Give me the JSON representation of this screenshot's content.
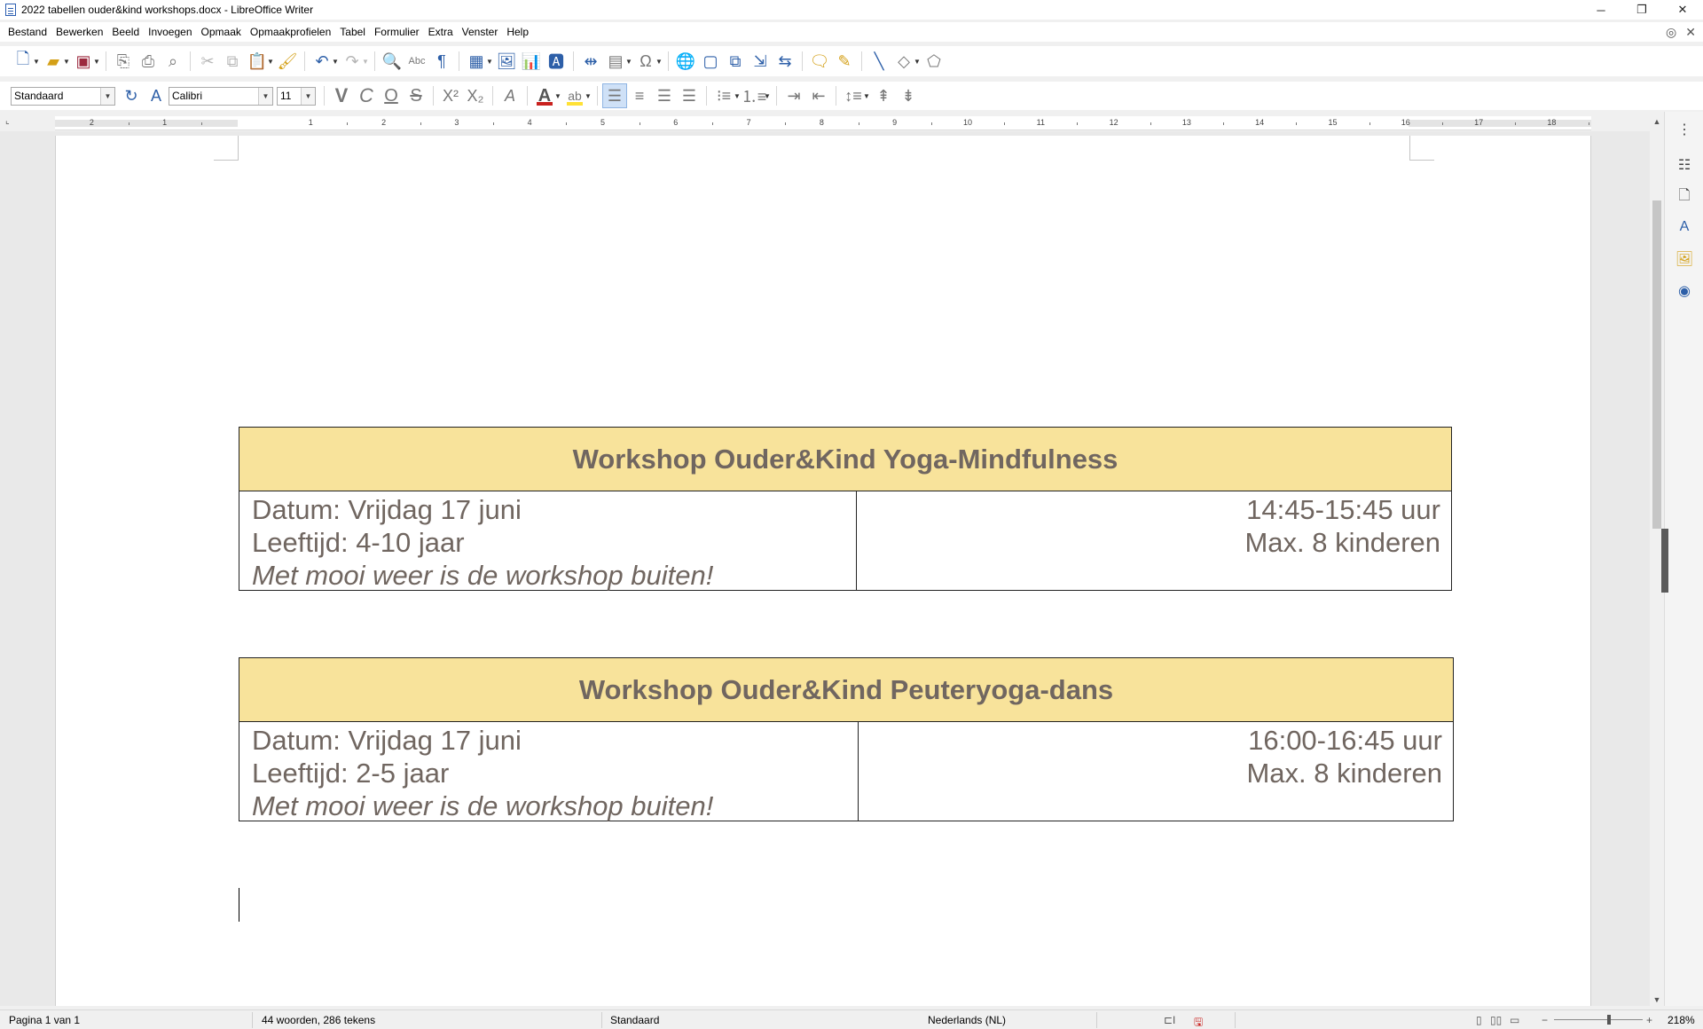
{
  "window": {
    "title": "2022 tabellen ouder&kind workshops.docx - LibreOffice Writer",
    "controls": {
      "minimize": "─",
      "restore": "❐",
      "close": "✕"
    }
  },
  "menubar": {
    "items": [
      "Bestand",
      "Bewerken",
      "Beeld",
      "Invoegen",
      "Opmaak",
      "Opmaakprofielen",
      "Tabel",
      "Formulier",
      "Extra",
      "Venster",
      "Help"
    ]
  },
  "formatting": {
    "paragraph_style": "Standaard",
    "font_name": "Calibri",
    "font_size": "11",
    "bold_label": "V",
    "italic_label": "C",
    "underline_label": "O",
    "strike_label": "S",
    "font_color": "#c9211e",
    "highlight_color": "#ffe135"
  },
  "ruler": {
    "numbers": [
      "2",
      "1",
      "1",
      "2",
      "3",
      "4",
      "5",
      "6",
      "7",
      "8",
      "9",
      "10",
      "11",
      "12",
      "13",
      "14",
      "15",
      "16",
      "17",
      "18"
    ]
  },
  "document": {
    "tables": [
      {
        "title": "Workshop Ouder&Kind Yoga-Mindfulness",
        "date": "Datum: Vrijdag 17 juni",
        "age": "Leeftijd: 4-10 jaar",
        "note": "Met mooi weer is de workshop buiten!",
        "time": "14:45-15:45 uur",
        "max": "Max. 8 kinderen"
      },
      {
        "title": "Workshop Ouder&Kind Peuteryoga-dans",
        "date": "Datum: Vrijdag 17 juni",
        "age": "Leeftijd: 2-5 jaar",
        "note": "Met mooi weer is de workshop buiten!",
        "time": "16:00-16:45 uur",
        "max": "Max. 8 kinderen"
      }
    ],
    "header_color": "#f8e39b",
    "text_color": "#706660"
  },
  "statusbar": {
    "page": "Pagina 1 van 1",
    "words": "44 woorden, 286 tekens",
    "style": "Standaard",
    "language": "Nederlands (NL)",
    "zoom": "218%"
  }
}
